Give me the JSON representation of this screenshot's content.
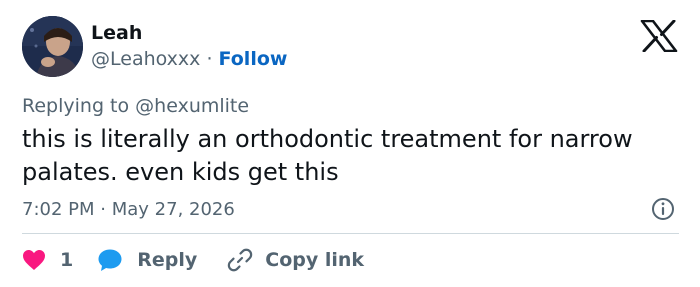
{
  "author": {
    "name": "Leah",
    "handle": "@Leahoxxx",
    "separator": "·",
    "follow_label": "Follow"
  },
  "reply_context": {
    "prefix": "Replying to",
    "mention": "@hexumlite"
  },
  "tweet": {
    "text": "this is literally an orthodontic treatment for narrow palates. even kids get this",
    "time": "7:02 PM",
    "separator": "·",
    "date": "May 27, 2026"
  },
  "actions": {
    "like_count": "1",
    "reply_label": "Reply",
    "copy_link_label": "Copy link"
  },
  "icons": {
    "brand": "x-logo-icon",
    "info": "info-icon",
    "like": "heart-icon",
    "reply": "speech-bubble-icon",
    "copy": "link-icon"
  },
  "colors": {
    "text": "#0f1419",
    "muted": "#536471",
    "follow": "#0a66c2",
    "heart": "#f91880",
    "reply_bubble": "#1d9bf0",
    "divider": "#cfd9de"
  }
}
